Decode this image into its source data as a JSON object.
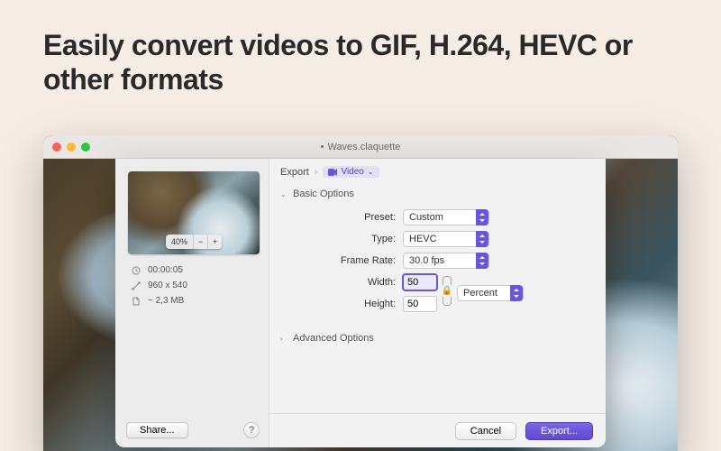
{
  "headline": "Easily convert videos to GIF, H.264, HEVC or other formats",
  "window": {
    "title": "Waves.claquette"
  },
  "preview": {
    "zoom_level": "40%",
    "duration": "00:00:05",
    "dimensions": "960 x 540",
    "filesize": "~ 2,3 MB"
  },
  "left_actions": {
    "share": "Share...",
    "help": "?"
  },
  "crumbs": {
    "root": "Export",
    "node": "Video"
  },
  "sections": {
    "basic": "Basic Options",
    "advanced": "Advanced Options"
  },
  "form": {
    "preset_label": "Preset:",
    "preset_value": "Custom",
    "type_label": "Type:",
    "type_value": "HEVC",
    "fps_label": "Frame Rate:",
    "fps_value": "30.0 fps",
    "width_label": "Width:",
    "width_value": "50",
    "height_label": "Height:",
    "height_value": "50",
    "unit_value": "Percent"
  },
  "footer": {
    "cancel": "Cancel",
    "export": "Export..."
  }
}
